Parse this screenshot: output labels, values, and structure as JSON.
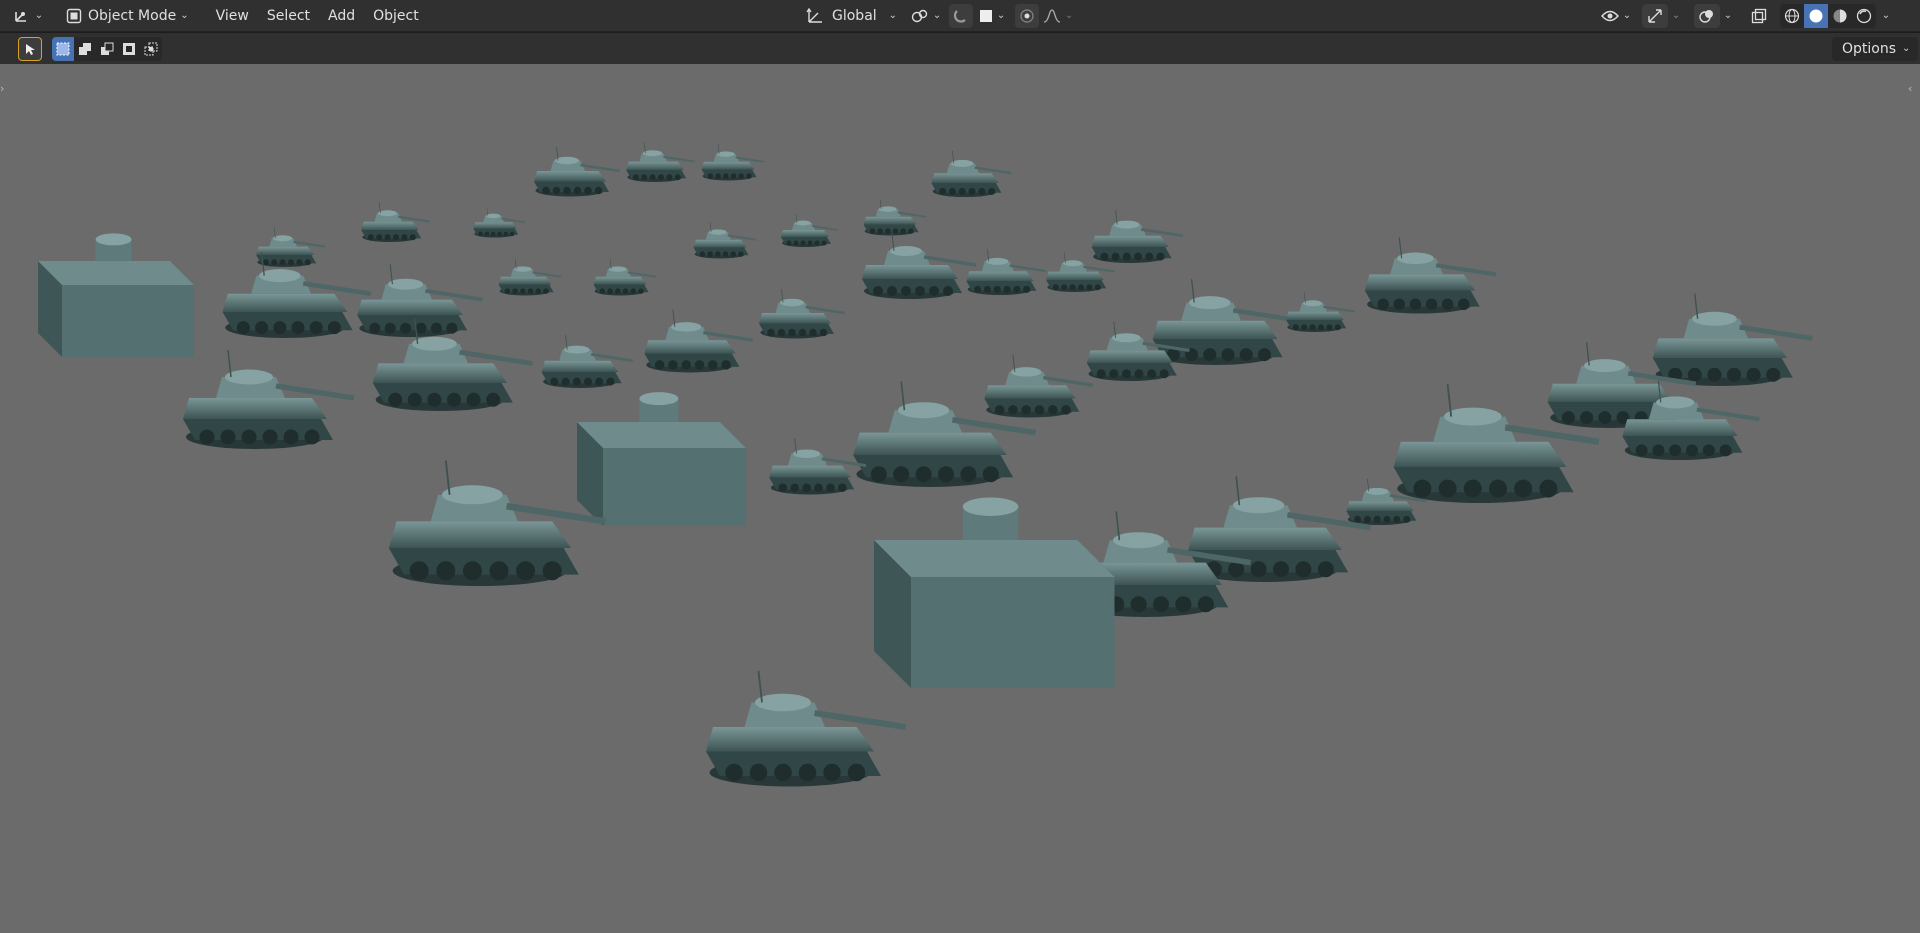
{
  "header": {
    "editor_type_icon": "axis-gizmo-icon",
    "mode_label": "Object Mode",
    "menus": [
      "View",
      "Select",
      "Add",
      "Object"
    ],
    "transform_orientation": "Global"
  },
  "tool_header": {
    "options_label": "Options"
  },
  "colors": {
    "header_bg": "#303030",
    "viewport_bg": "#6b6b6b",
    "accent": "#4772b3",
    "model_color": "#5f7d7d"
  }
}
